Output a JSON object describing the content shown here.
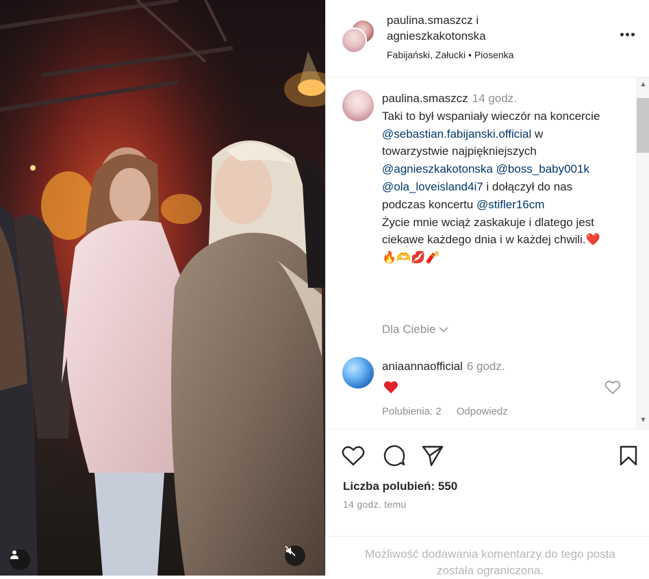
{
  "header": {
    "users_line1": "paulina.smaszcz i",
    "users_line2": "agnieszkakotonska",
    "subtitle": "Fabijański, Załucki • Piosenka",
    "more_icon": "more-horizontal-icon"
  },
  "caption": {
    "username": "paulina.smaszcz",
    "time": "14 godz.",
    "text1": "Taki to był wspaniały wieczór na koncercie",
    "mention1": "@sebastian.fabijanski.official",
    "text2": "w towarzystwie najpiękniejszych",
    "mention2": "@agnieszkakotonska",
    "mention3": "@boss_baby001k",
    "mention4": "@ola_loveisland4i7",
    "text3": "i dołączył do nas podczas koncertu",
    "mention5": "@stifler16cm",
    "text4": "Życie mnie wciąż zaskakuje i dlatego jest ciekawe każdego dnia i w każdej chwili.",
    "emojis": "❤️🔥🫶💋🧨"
  },
  "dla_ciebie": "Dla Ciebie",
  "comment": {
    "username": "aniaannaofficial",
    "time": "6 godz.",
    "text": "❤️",
    "likes": "Polubienia: 2",
    "reply": "Odpowiedz"
  },
  "actions": {
    "like_icon": "heart-icon",
    "comment_icon": "comment-icon",
    "share_icon": "send-icon",
    "save_icon": "bookmark-icon"
  },
  "likes_count": "Liczba polubień: 550",
  "posted_ago": "14 godz. temu",
  "comments_restricted": "Możliwość dodawania komentarzy do tego posta została ograniczona.",
  "colors": {
    "link": "#00376b",
    "secondary": "#8e8e8e",
    "heart": "#e0242c"
  }
}
